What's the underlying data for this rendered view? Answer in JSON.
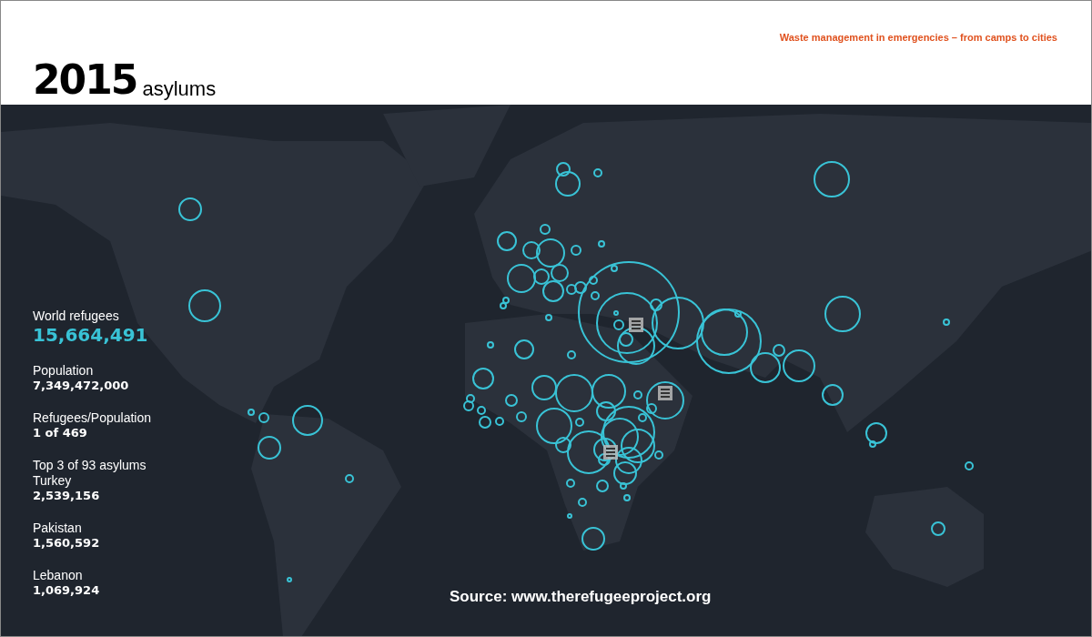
{
  "header": {
    "year": "2015",
    "subtitle": "asylums",
    "tagline": "Waste management in emergencies – from camps to cities"
  },
  "stats": [
    {
      "kind": "highlight",
      "label": "World refugees",
      "value": "15,664,491"
    },
    {
      "kind": "plain",
      "label": "Population",
      "value": "7,349,472,000"
    },
    {
      "kind": "plain",
      "label": "Refugees/Population",
      "value": "1 of 469"
    },
    {
      "kind": "plain",
      "heading": "Top 3 of 93 asylums",
      "label": "Turkey",
      "value": "2,539,156"
    },
    {
      "kind": "plain",
      "label": "Pakistan",
      "value": "1,560,592"
    },
    {
      "kind": "plain",
      "label": "Lebanon",
      "value": "1,069,924"
    }
  ],
  "source": "Source: www.therefugeeproject.org"
}
